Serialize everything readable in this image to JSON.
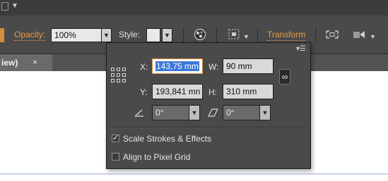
{
  "top_strip": {
    "icon": "document-icon",
    "caret": "▼"
  },
  "control_bar": {
    "opacity_label": "Opacity:",
    "opacity_value": "100%",
    "style_label": "Style:",
    "transform_label": "Transform",
    "icons": [
      "recolor-icon",
      "align-selection-icon",
      "transform-each-icon",
      "isolate-icon"
    ]
  },
  "document_tab": {
    "label": "iew)",
    "close": "×"
  },
  "transform_panel": {
    "menu": "▾☰",
    "x_label": "X:",
    "x_value": "143,75 mm",
    "y_label": "Y:",
    "y_value": "193,841 mn",
    "w_label": "W:",
    "w_value": "90 mm",
    "h_label": "H:",
    "h_value": "310 mm",
    "rotate_value": "0°",
    "shear_value": "0°",
    "scale_strokes_label": "Scale Strokes & Effects",
    "scale_strokes_checked": true,
    "align_pixel_label": "Align to Pixel Grid",
    "align_pixel_checked": false
  },
  "colors": {
    "accent_orange": "#f29a3e",
    "panel_bg": "#4a4a4a",
    "selection_blue": "#3d78d8"
  }
}
